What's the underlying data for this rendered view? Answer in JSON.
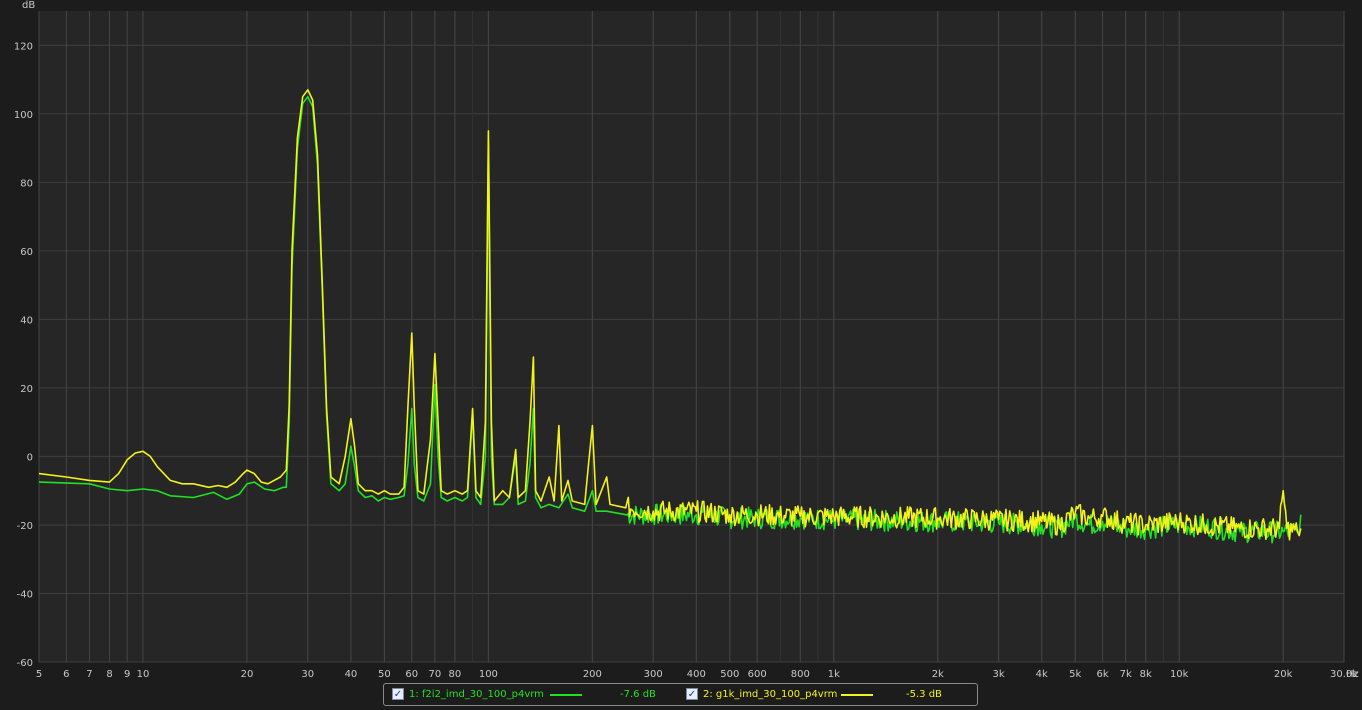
{
  "chart_data": {
    "type": "line",
    "xscale": "log",
    "xlim": [
      5,
      30000
    ],
    "ylim": [
      -60,
      130
    ],
    "grid": true,
    "yunit": "dB",
    "xunit": "Hz",
    "y_ticks": [
      "120",
      "100",
      "80",
      "60",
      "40",
      "20",
      "0",
      "-20",
      "-40",
      "-60"
    ],
    "x_ticks": [
      {
        "v": 5,
        "label": "5"
      },
      {
        "v": 6,
        "label": "6"
      },
      {
        "v": 7,
        "label": "7"
      },
      {
        "v": 8,
        "label": "8"
      },
      {
        "v": 9,
        "label": "9"
      },
      {
        "v": 10,
        "label": "10"
      },
      {
        "v": 20,
        "label": "20"
      },
      {
        "v": 30,
        "label": "30"
      },
      {
        "v": 40,
        "label": "40"
      },
      {
        "v": 50,
        "label": "50"
      },
      {
        "v": 60,
        "label": "60"
      },
      {
        "v": 70,
        "label": "70"
      },
      {
        "v": 80,
        "label": "80"
      },
      {
        "v": 100,
        "label": "100"
      },
      {
        "v": 200,
        "label": "200"
      },
      {
        "v": 300,
        "label": "300"
      },
      {
        "v": 400,
        "label": "400"
      },
      {
        "v": 500,
        "label": "500"
      },
      {
        "v": 600,
        "label": "600"
      },
      {
        "v": 800,
        "label": "800"
      },
      {
        "v": 1000,
        "label": "1k"
      },
      {
        "v": 2000,
        "label": "2k"
      },
      {
        "v": 3000,
        "label": "3k"
      },
      {
        "v": 4000,
        "label": "4k"
      },
      {
        "v": 5000,
        "label": "5k"
      },
      {
        "v": 6000,
        "label": "6k"
      },
      {
        "v": 7000,
        "label": "7k"
      },
      {
        "v": 8000,
        "label": "8k"
      },
      {
        "v": 10000,
        "label": "10k"
      },
      {
        "v": 20000,
        "label": "20k"
      },
      {
        "v": 30000,
        "label": "30.0k"
      }
    ],
    "series": [
      {
        "name": "1: f2i2_imd_30_100_p4vrm",
        "level": "-7.6 dB",
        "color": "#22e022",
        "points": [
          [
            5,
            -7.5
          ],
          [
            7,
            -8
          ],
          [
            8,
            -9.5
          ],
          [
            9,
            -10
          ],
          [
            10,
            -9.5
          ],
          [
            11,
            -10
          ],
          [
            12,
            -11.5
          ],
          [
            14,
            -12
          ],
          [
            16,
            -10.5
          ],
          [
            17.5,
            -12.5
          ],
          [
            19,
            -11
          ],
          [
            20,
            -8
          ],
          [
            21,
            -7.5
          ],
          [
            22.5,
            -9.5
          ],
          [
            24,
            -10
          ],
          [
            25.5,
            -9
          ],
          [
            26,
            -9
          ],
          [
            26.5,
            10
          ],
          [
            27,
            55
          ],
          [
            28,
            90
          ],
          [
            29,
            103
          ],
          [
            30,
            105
          ],
          [
            31,
            102
          ],
          [
            32,
            85
          ],
          [
            33,
            50
          ],
          [
            34,
            12
          ],
          [
            35,
            -8
          ],
          [
            37,
            -10
          ],
          [
            38.5,
            -8
          ],
          [
            40,
            3
          ],
          [
            41,
            -3
          ],
          [
            42,
            -10
          ],
          [
            44,
            -12
          ],
          [
            46,
            -11.5
          ],
          [
            48,
            -13
          ],
          [
            50,
            -12
          ],
          [
            52,
            -12.5
          ],
          [
            55,
            -12
          ],
          [
            57,
            -11.5
          ],
          [
            58.5,
            -2
          ],
          [
            60,
            14
          ],
          [
            61,
            -2
          ],
          [
            62.5,
            -12
          ],
          [
            65,
            -13
          ],
          [
            68,
            -8
          ],
          [
            70,
            21
          ],
          [
            71.5,
            0
          ],
          [
            73,
            -12
          ],
          [
            76,
            -13
          ],
          [
            80,
            -12
          ],
          [
            84,
            -13
          ],
          [
            87,
            -12
          ],
          [
            90,
            13
          ],
          [
            92,
            -12
          ],
          [
            95,
            -14
          ],
          [
            98,
            0
          ],
          [
            100,
            92
          ],
          [
            102,
            0
          ],
          [
            104,
            -14
          ],
          [
            110,
            -14
          ],
          [
            115,
            -12
          ],
          [
            120,
            0
          ],
          [
            122,
            -14
          ],
          [
            128,
            -13
          ],
          [
            132,
            -2
          ],
          [
            135,
            14
          ],
          [
            137,
            -12
          ],
          [
            142,
            -15
          ],
          [
            150,
            -14
          ],
          [
            160,
            -15
          ],
          [
            170,
            -11
          ],
          [
            175,
            -15
          ],
          [
            190,
            -16
          ],
          [
            200,
            -10
          ],
          [
            205,
            -16
          ],
          [
            220,
            -16
          ],
          [
            250,
            -17
          ],
          [
            300,
            -17
          ],
          [
            400,
            -17
          ],
          [
            500,
            -18
          ],
          [
            600,
            -18
          ],
          [
            800,
            -18
          ],
          [
            1000,
            -18.5
          ],
          [
            2000,
            -19
          ],
          [
            3000,
            -19.5
          ],
          [
            4000,
            -20
          ],
          [
            4500,
            -21
          ],
          [
            5000,
            -18
          ],
          [
            5500,
            -20
          ],
          [
            6000,
            -19
          ],
          [
            7000,
            -21
          ],
          [
            8000,
            -21
          ],
          [
            10000,
            -20
          ],
          [
            12000,
            -20.5
          ],
          [
            15000,
            -22
          ],
          [
            20000,
            -22
          ],
          [
            22000,
            -22
          ],
          [
            22500,
            -17
          ]
        ]
      },
      {
        "name": "2: g1k_imd_30_100_p4vrm",
        "level": "-5.3 dB",
        "color": "#f2f21c",
        "points": [
          [
            5,
            -5
          ],
          [
            6,
            -6
          ],
          [
            7,
            -7
          ],
          [
            8,
            -7.5
          ],
          [
            8.5,
            -5
          ],
          [
            9,
            -1
          ],
          [
            9.5,
            1
          ],
          [
            10,
            1.5
          ],
          [
            10.5,
            0
          ],
          [
            11,
            -3
          ],
          [
            12,
            -7
          ],
          [
            13,
            -8
          ],
          [
            14,
            -8
          ],
          [
            15.5,
            -9
          ],
          [
            16.5,
            -8.5
          ],
          [
            17.5,
            -9
          ],
          [
            18.5,
            -7.5
          ],
          [
            19.5,
            -5
          ],
          [
            20,
            -4
          ],
          [
            21,
            -5
          ],
          [
            22,
            -7.5
          ],
          [
            23,
            -8
          ],
          [
            25,
            -6
          ],
          [
            26,
            -4
          ],
          [
            26.5,
            15
          ],
          [
            27,
            60
          ],
          [
            28,
            93
          ],
          [
            29,
            105
          ],
          [
            30,
            107
          ],
          [
            31,
            104
          ],
          [
            32,
            88
          ],
          [
            33,
            52
          ],
          [
            34,
            14
          ],
          [
            35,
            -6
          ],
          [
            37,
            -8
          ],
          [
            38.5,
            0
          ],
          [
            40,
            11
          ],
          [
            41,
            3
          ],
          [
            42,
            -8
          ],
          [
            44,
            -10
          ],
          [
            46,
            -10
          ],
          [
            48,
            -11
          ],
          [
            50,
            -10
          ],
          [
            52,
            -11
          ],
          [
            55,
            -11
          ],
          [
            57,
            -9
          ],
          [
            58.5,
            15
          ],
          [
            60,
            36
          ],
          [
            61,
            15
          ],
          [
            62.5,
            -10
          ],
          [
            65,
            -11
          ],
          [
            68,
            5
          ],
          [
            70,
            30
          ],
          [
            71.5,
            10
          ],
          [
            73,
            -10
          ],
          [
            76,
            -11
          ],
          [
            80,
            -10
          ],
          [
            84,
            -11
          ],
          [
            87,
            -10
          ],
          [
            90,
            14
          ],
          [
            92,
            -10
          ],
          [
            95,
            -12
          ],
          [
            98,
            10
          ],
          [
            100,
            95
          ],
          [
            102,
            10
          ],
          [
            104,
            -13
          ],
          [
            110,
            -10
          ],
          [
            115,
            -12
          ],
          [
            120,
            2
          ],
          [
            122,
            -12
          ],
          [
            128,
            -10
          ],
          [
            132,
            10
          ],
          [
            135,
            29
          ],
          [
            137,
            -10
          ],
          [
            142,
            -13
          ],
          [
            150,
            -6
          ],
          [
            155,
            -13
          ],
          [
            160,
            9
          ],
          [
            163,
            -13
          ],
          [
            170,
            -7
          ],
          [
            175,
            -13
          ],
          [
            190,
            -14
          ],
          [
            195,
            -2
          ],
          [
            200,
            9
          ],
          [
            205,
            -14
          ],
          [
            220,
            -6
          ],
          [
            225,
            -14
          ],
          [
            250,
            -15
          ],
          [
            300,
            -16
          ],
          [
            400,
            -16
          ],
          [
            500,
            -17
          ],
          [
            600,
            -17
          ],
          [
            800,
            -17.5
          ],
          [
            1000,
            -17.5
          ],
          [
            2000,
            -18
          ],
          [
            3000,
            -18.5
          ],
          [
            4000,
            -19
          ],
          [
            4500,
            -20
          ],
          [
            5000,
            -16.5
          ],
          [
            5500,
            -18
          ],
          [
            6000,
            -17.5
          ],
          [
            7000,
            -19.5
          ],
          [
            8000,
            -20
          ],
          [
            10000,
            -19
          ],
          [
            12000,
            -20
          ],
          [
            15000,
            -21
          ],
          [
            19500,
            -21
          ],
          [
            20000,
            -10
          ],
          [
            20500,
            -21
          ],
          [
            22000,
            -22
          ],
          [
            22500,
            -21
          ]
        ]
      }
    ]
  }
}
